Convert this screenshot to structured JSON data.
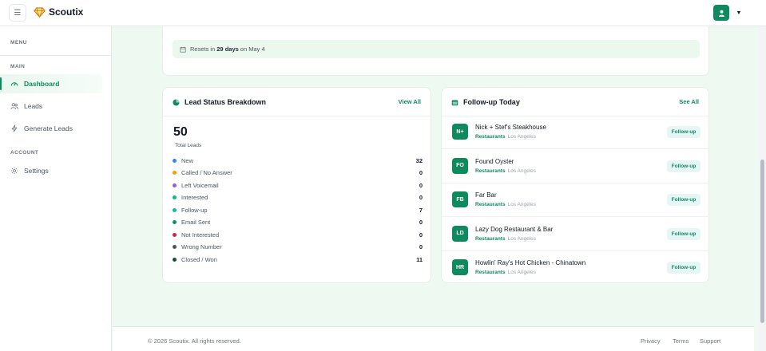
{
  "app": {
    "brand": "Scoutix"
  },
  "sidebar": {
    "menu_label": "MENU",
    "main_label": "MAIN",
    "account_label": "ACCOUNT",
    "items": [
      {
        "label": "Dashboard",
        "icon": "gauge-icon"
      },
      {
        "label": "Leads",
        "icon": "users-icon"
      },
      {
        "label": "Generate Leads",
        "icon": "bolt-icon"
      },
      {
        "label": "Settings",
        "icon": "gear-icon"
      }
    ]
  },
  "usage": {
    "reset_prefix": "Resets in",
    "reset_days": "29 days",
    "reset_suffix": "on May 4"
  },
  "breakdown": {
    "title": "Lead Status Breakdown",
    "view_all": "View All",
    "total": "50",
    "total_label": "Total Leads",
    "statuses": [
      {
        "label": "New",
        "value": "32",
        "color": "#3b82f6"
      },
      {
        "label": "Called / No Answer",
        "value": "0",
        "color": "#f59e0b"
      },
      {
        "label": "Left Voicemail",
        "value": "0",
        "color": "#8b5cf6"
      },
      {
        "label": "Interested",
        "value": "0",
        "color": "#10b981"
      },
      {
        "label": "Follow-up",
        "value": "7",
        "color": "#14b8a6"
      },
      {
        "label": "Email Sent",
        "value": "0",
        "color": "#059669"
      },
      {
        "label": "Not Interested",
        "value": "0",
        "color": "#e11d48"
      },
      {
        "label": "Wrong Number",
        "value": "0",
        "color": "#4b5563"
      },
      {
        "label": "Closed / Won",
        "value": "11",
        "color": "#14532d"
      }
    ]
  },
  "followup": {
    "title": "Follow-up Today",
    "see_all": "See All",
    "items": [
      {
        "initials": "N+",
        "name": "Nick + Stef's Steakhouse",
        "category": "Restaurants",
        "location": "Los Angeles",
        "action": "Follow-up"
      },
      {
        "initials": "FO",
        "name": "Found Oyster",
        "category": "Restaurants",
        "location": "Los Angeles",
        "action": "Follow-up"
      },
      {
        "initials": "FB",
        "name": "Far Bar",
        "category": "Restaurants",
        "location": "Los Angeles",
        "action": "Follow-up"
      },
      {
        "initials": "LD",
        "name": "Lazy Dog Restaurant & Bar",
        "category": "Restaurants",
        "location": "Los Angeles",
        "action": "Follow-up"
      },
      {
        "initials": "HR",
        "name": "Howlin' Ray's Hot Chicken - Chinatown",
        "category": "Restaurants",
        "location": "Los Angeles",
        "action": "Follow-up"
      }
    ]
  },
  "footer": {
    "copyright": "© 2026 Scoutix. All rights reserved.",
    "links": [
      "Privacy",
      "Terms",
      "Support"
    ]
  },
  "colors": {
    "accent": "#0f8a5f",
    "background": "#eef9f1"
  }
}
